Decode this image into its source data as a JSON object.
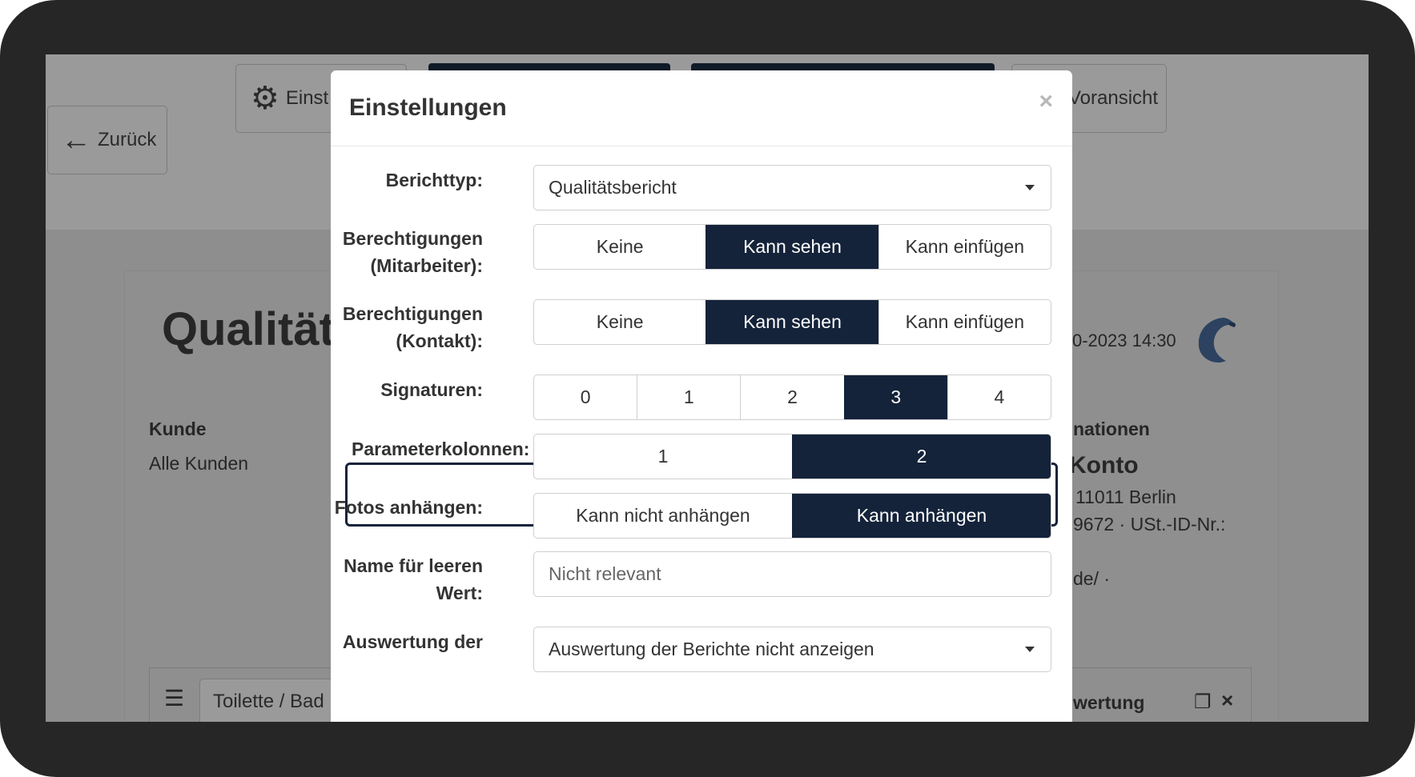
{
  "background": {
    "back_label": "Zurück",
    "settings_label_partial": "Einst",
    "preview_label_partial": "Voransicht",
    "report_title_partial": "Qualitäts",
    "date_partial": "0-2023 14:30",
    "kunde_label": "Kunde",
    "kunde_value": "Alle Kunden",
    "info_heading_partial": "nationen",
    "account_partial": "Konto",
    "address_partial": "11011 Berlin",
    "tax_partial": "9672 · USt.-ID-Nr.:",
    "web_partial": "de/ ·",
    "row_input_value": "Toilette / Bad",
    "row_right_partial": "wertung"
  },
  "modal": {
    "title": "Einstellungen",
    "close_symbol": "×",
    "report_type": {
      "label": "Berichttyp:",
      "value": "Qualitätsbericht"
    },
    "perm_staff": {
      "label_line1": "Berechtigungen",
      "label_line2": "(Mitarbeiter):",
      "options": [
        "Keine",
        "Kann sehen",
        "Kann einfügen"
      ],
      "selected": "Kann sehen"
    },
    "perm_contact": {
      "label_line1": "Berechtigungen",
      "label_line2": "(Kontakt):",
      "options": [
        "Keine",
        "Kann sehen",
        "Kann einfügen"
      ],
      "selected": "Kann sehen"
    },
    "signatures": {
      "label": "Signaturen:",
      "options": [
        "0",
        "1",
        "2",
        "3",
        "4"
      ],
      "selected": "3"
    },
    "param_columns": {
      "label": "Parameterkolonnen:",
      "options": [
        "1",
        "2"
      ],
      "selected": "2"
    },
    "photos": {
      "label": "Fotos anhängen:",
      "options": [
        "Kann nicht anhängen",
        "Kann anhängen"
      ],
      "selected": "Kann anhängen"
    },
    "empty_value_name": {
      "label_line1": "Name für leeren",
      "label_line2": "Wert:",
      "placeholder": "Nicht relevant"
    },
    "evaluation": {
      "label_line1": "Auswertung der",
      "value": "Auswertung der Berichte nicht anzeigen"
    }
  }
}
